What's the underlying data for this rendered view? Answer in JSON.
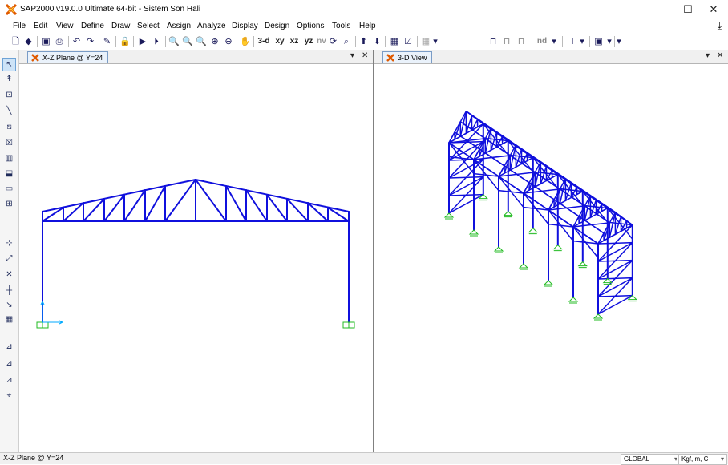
{
  "window": {
    "title": "SAP2000 v19.0.0 Ultimate 64-bit - Sistem Son Hali",
    "controls": [
      "—",
      "☐",
      "✕"
    ]
  },
  "menu": {
    "items": [
      "File",
      "Edit",
      "View",
      "Define",
      "Draw",
      "Select",
      "Assign",
      "Analyze",
      "Display",
      "Design",
      "Options",
      "Tools",
      "Help"
    ]
  },
  "toolbar": {
    "text_buttons": [
      "3-d",
      "xy",
      "xz",
      "yz",
      "nv",
      "nd"
    ]
  },
  "panes": {
    "left": {
      "tab_title": "X-Z Plane @ Y=24"
    },
    "right": {
      "tab_title": "3-D View"
    }
  },
  "status": {
    "text": "X-Z Plane @ Y=24",
    "coord_system": "GLOBAL",
    "units": "Kgf, m, C"
  },
  "colors": {
    "frame_members": "#1010dd",
    "supports": "#22bb22",
    "axis": "#00aaff",
    "app_icon": "#e05a00"
  }
}
